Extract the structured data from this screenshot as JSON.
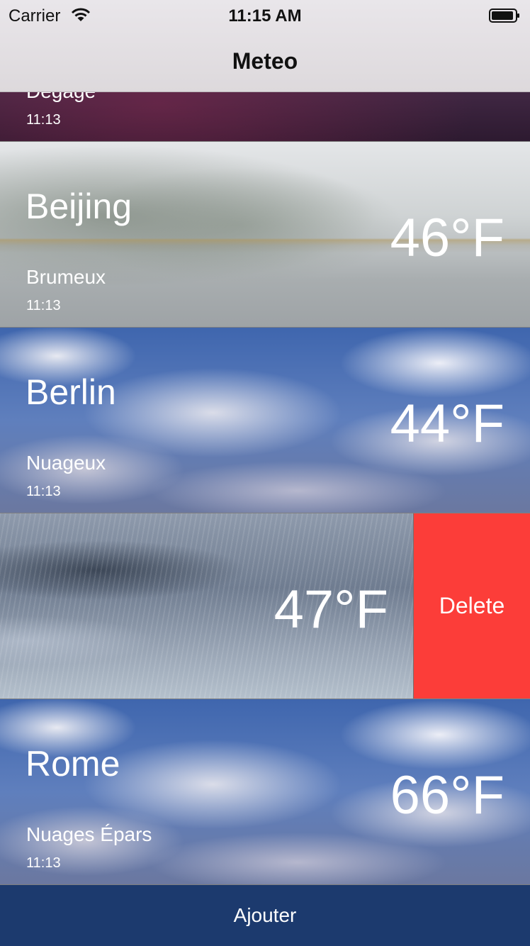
{
  "status_bar": {
    "carrier": "Carrier",
    "time": "11:15 AM"
  },
  "nav": {
    "title": "Meteo"
  },
  "cities": [
    {
      "city": "",
      "condition": "Dégagé",
      "time": "11:13",
      "temp": ""
    },
    {
      "city": "Beijing",
      "condition": "Brumeux",
      "time": "11:13",
      "temp": "46°F"
    },
    {
      "city": "Berlin",
      "condition": "Nuageux",
      "time": "11:13",
      "temp": "44°F"
    },
    {
      "city": "",
      "condition": "",
      "time": "",
      "temp": "47°F"
    },
    {
      "city": "Rome",
      "condition": "Nuages Épars",
      "time": "11:13",
      "temp": "66°F"
    }
  ],
  "swipe_action": {
    "delete_label": "Delete",
    "color": "#fc3d39"
  },
  "bottom": {
    "add_label": "Ajouter",
    "color": "#1c3a6e"
  },
  "icons": [
    "wifi-icon",
    "battery-icon"
  ]
}
